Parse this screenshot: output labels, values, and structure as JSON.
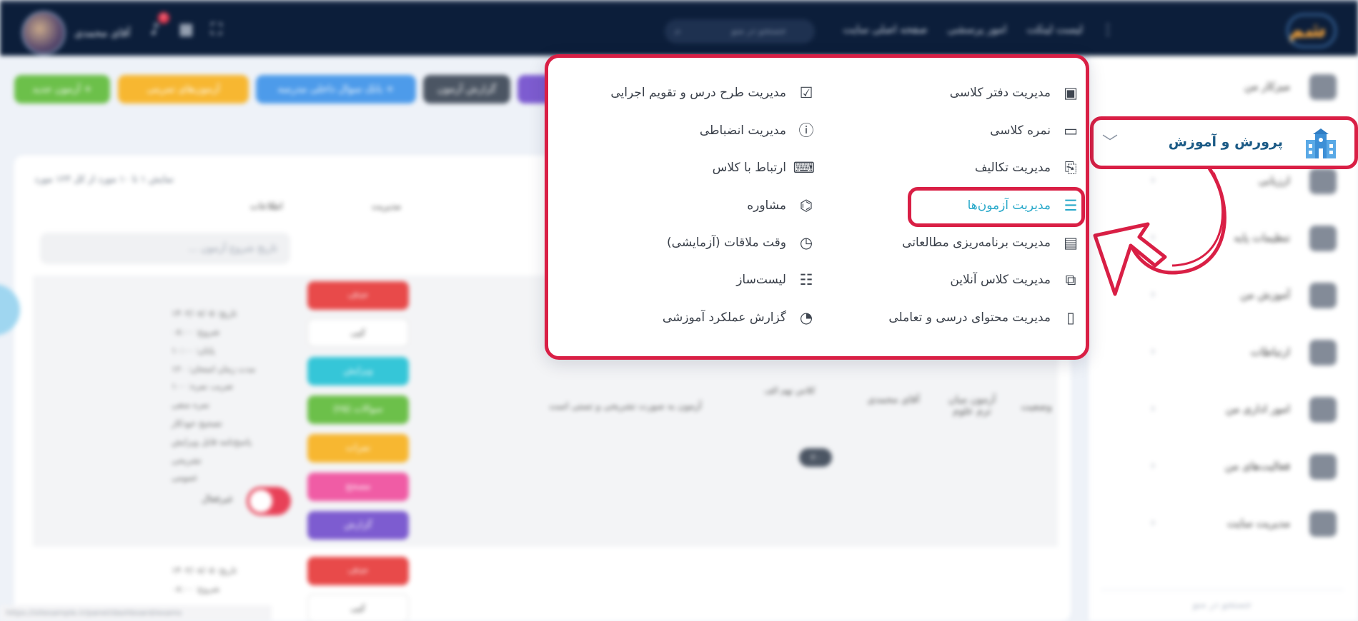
{
  "topbar": {
    "logo_text": "شم",
    "nav_links": [
      "لیست لینکت",
      "امور پرسشی",
      "صفحه اصلی سایت"
    ],
    "search_placeholder": "جستجو در منو",
    "user_name": "آقای محمدی",
    "notification_count": "۲"
  },
  "sidebar": {
    "items": [
      {
        "label": "میزکار من",
        "icon": "dashboard-icon"
      },
      {
        "label": "پرورش و آموزش",
        "icon": "school-building-icon"
      },
      {
        "label": "ارزیابی",
        "icon": "evaluation-icon"
      },
      {
        "label": "تنظیمات پایه",
        "icon": "settings-icon"
      },
      {
        "label": "آموزش من",
        "icon": "graduation-cap-icon"
      },
      {
        "label": "ارتباطات",
        "icon": "communication-icon"
      },
      {
        "label": "امور اداری من",
        "icon": "office-icon"
      },
      {
        "label": "فعالیت‌های من",
        "icon": "activities-icon"
      },
      {
        "label": "مدیریت سایت",
        "icon": "site-admin-icon"
      }
    ],
    "filter_placeholder": "جستجو در منو"
  },
  "toolbar": {
    "new_exam": "+ آزمون جدید",
    "training_exams": "آزمون‌های تمرینی",
    "question_bank": "+ بانک سوال داخلی مدرسه",
    "exam_reports": "گزارش آزمون",
    "purple_btn": ""
  },
  "table": {
    "showing": "نمایش ۱ تا ۱۰ مورد از کل ۱۲۳ مورد",
    "col_management": "مدیریت",
    "col_info": "اطلاعات",
    "filter_placeholder": "تاریخ شروع آزمون ...",
    "row1": {
      "status": "وضعیت",
      "title": "آزمون میان ترم علوم",
      "teacher": "آقای محمدی",
      "type_text": "آزمون به صورت تشریحی و تستی است",
      "class_info": "کلاس نهم الف",
      "tag": "۲۰"
    },
    "actions": [
      "حذف",
      "کپی",
      "ویرایش",
      "سوالات (۲۵)",
      "نمرات",
      "مصحح",
      "گزارش"
    ],
    "info_lines": [
      "تاریخ: ۱۴۰۲/۰۸/۰۵",
      "شروع: ۰۸:۰۰",
      "پایان: ۱۰:۰۰",
      "مدت زمان امتحان: ۱۲۰",
      "ضریب نمره: ۱۰۰",
      "نمره منفی",
      "تصحیح خودکار",
      "پاسخ‌نامه قابل ویرایش",
      "تشریحی",
      "عمومی"
    ],
    "toggle_label": "غیرفعال",
    "status_url": "https://sitesample.ir/panel/dashboard/exams"
  },
  "mega_menu": {
    "right_column": [
      {
        "label": "مدیریت دفتر کلاسی",
        "icon": "class-book-icon"
      },
      {
        "label": "نمره کلاسی",
        "icon": "open-book-icon"
      },
      {
        "label": "مدیریت تکالیف",
        "icon": "assignment-icon"
      },
      {
        "label": "مدیریت آزمون‌ها",
        "icon": "exam-checklist-icon",
        "active": true
      },
      {
        "label": "مدیریت برنامه‌ریزی مطالعاتی",
        "icon": "calendar-icon"
      },
      {
        "label": "مدیریت کلاس آنلاین",
        "icon": "online-class-icon"
      },
      {
        "label": "مدیریت محتوای درسی و تعاملی",
        "icon": "content-file-icon"
      }
    ],
    "left_column": [
      {
        "label": "مدیریت طرح درس و تقویم اجرایی",
        "icon": "lesson-plan-icon"
      },
      {
        "label": "مدیریت انضباطی",
        "icon": "discipline-icon"
      },
      {
        "label": "ارتباط با کلاس",
        "icon": "class-contact-icon"
      },
      {
        "label": "مشاوره",
        "icon": "consulting-icon"
      },
      {
        "label": "وقت ملاقات (آزمایشی)",
        "icon": "appointment-icon"
      },
      {
        "label": "لیست‌ساز",
        "icon": "list-builder-icon"
      },
      {
        "label": "گزارش عملکرد آموزشی",
        "icon": "performance-report-icon"
      }
    ]
  },
  "colors": {
    "highlight": "#d91f45",
    "active_text": "#27a8c9",
    "topbar_bg": "#0c1e3a"
  }
}
